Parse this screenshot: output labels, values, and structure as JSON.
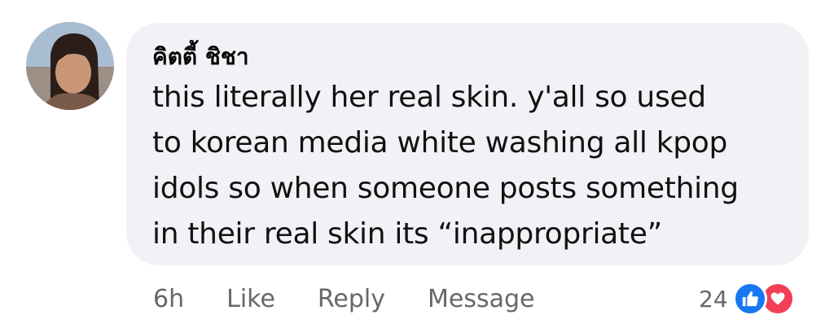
{
  "comment": {
    "author": "คิตตี้ ชิชา",
    "text": "this literally her real skin. y'all so used\nto korean media white washing all kpop\nidols so when someone posts something\nin their real skin its “inappropriate”",
    "time": "6h",
    "actions": {
      "like": "Like",
      "reply": "Reply",
      "message": "Message"
    },
    "reaction_count": "24",
    "reactions": [
      "like-icon",
      "love-icon"
    ]
  },
  "colors": {
    "bubble": "#f0f2f5",
    "like": "#1877f2",
    "love": "#f33e58",
    "secondary_text": "#65676b"
  }
}
